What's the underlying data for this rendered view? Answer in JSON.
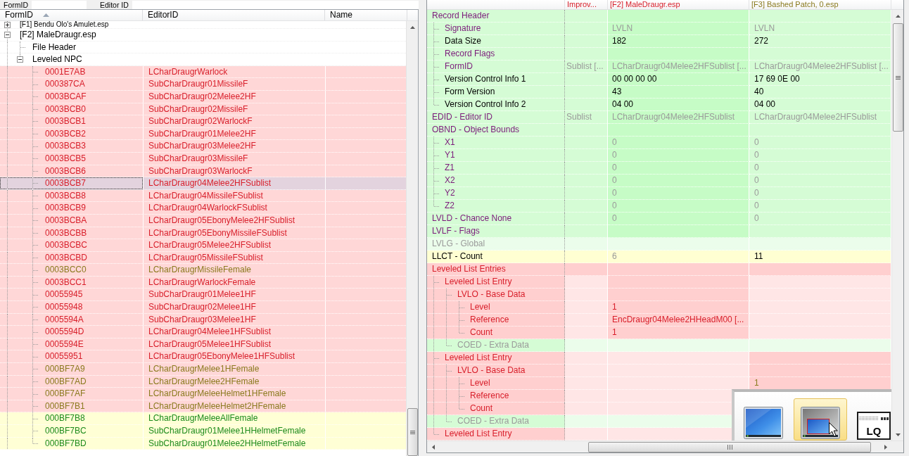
{
  "filter_bar": [
    {
      "label": "FormID"
    },
    {
      "label": "Editor ID"
    }
  ],
  "navigator": {
    "columns": [
      {
        "label": "FormID",
        "sorted": true
      },
      {
        "label": "EditorID",
        "sorted": false
      },
      {
        "label": "Name",
        "sorted": false
      }
    ],
    "tree": [
      {
        "label": "[F1] Bendu Olo's Amulet.esp",
        "expanded": false
      },
      {
        "label": "[F2] MaleDraugr.esp",
        "expanded": true,
        "children": [
          {
            "label": "File Header"
          },
          {
            "label": "Leveled NPC",
            "expanded": true,
            "children": [
              {
                "form_id": "0001E7AB",
                "editor_id": "LCharDraugrWarlock",
                "color": "#d81e2a",
                "fill": {
                  "color": "#ffd7d7"
                },
                "selected": false
              },
              {
                "form_id": "000387CA",
                "editor_id": "SubCharDraugr01MissileF",
                "color": "#d81e2a",
                "fill": {
                  "color": "#ffd7d7"
                },
                "selected": false
              },
              {
                "form_id": "0003BCAF",
                "editor_id": "SubCharDraugr02Melee2HF",
                "color": "#d81e2a",
                "fill": {
                  "color": "#ffd7d7"
                },
                "selected": false
              },
              {
                "form_id": "0003BCB0",
                "editor_id": "SubCharDraugr02MissileF",
                "color": "#d81e2a",
                "fill": {
                  "color": "#ffd7d7"
                },
                "selected": false
              },
              {
                "form_id": "0003BCB1",
                "editor_id": "SubCharDraugr02WarlockF",
                "color": "#d81e2a",
                "fill": {
                  "color": "#ffd7d7"
                },
                "selected": false
              },
              {
                "form_id": "0003BCB2",
                "editor_id": "SubCharDraugr01Melee2HF",
                "color": "#d81e2a",
                "fill": {
                  "color": "#ffd7d7"
                },
                "selected": false
              },
              {
                "form_id": "0003BCB3",
                "editor_id": "SubCharDraugr03Melee2HF",
                "color": "#d81e2a",
                "fill": {
                  "color": "#ffd7d7"
                },
                "selected": false
              },
              {
                "form_id": "0003BCB5",
                "editor_id": "SubCharDraugr03MissileF",
                "color": "#d81e2a",
                "fill": {
                  "color": "#ffd7d7"
                },
                "selected": false
              },
              {
                "form_id": "0003BCB6",
                "editor_id": "SubCharDraugr03WarlockF",
                "color": "#d81e2a",
                "fill": {
                  "color": "#ffd7d7"
                },
                "selected": false
              },
              {
                "form_id": "0003BCB7",
                "editor_id": "LCharDraugr04Melee2HFSublist",
                "color": "#d81e2a",
                "selected": true
              },
              {
                "form_id": "0003BCB8",
                "editor_id": "LCharDraugr04MissileFSublist",
                "color": "#d81e2a",
                "fill": {
                  "color": "#ffd7d7"
                },
                "selected": false
              },
              {
                "form_id": "0003BCB9",
                "editor_id": "LCharDraugr04WarlockFSublist",
                "color": "#d81e2a",
                "fill": {
                  "color": "#ffd7d7"
                },
                "selected": false
              },
              {
                "form_id": "0003BCBA",
                "editor_id": "LCharDraugr05EbonyMelee2HFSublist",
                "color": "#d81e2a",
                "fill": {
                  "color": "#ffd7d7"
                },
                "selected": false
              },
              {
                "form_id": "0003BCBB",
                "editor_id": "LCharDraugr05EbonyMissileFSublist",
                "color": "#d81e2a",
                "fill": {
                  "color": "#ffd7d7"
                },
                "selected": false
              },
              {
                "form_id": "0003BCBC",
                "editor_id": "LCharDraugr05Melee2HFSublist",
                "color": "#d81e2a",
                "fill": {
                  "color": "#ffd7d7"
                },
                "selected": false
              },
              {
                "form_id": "0003BCBD",
                "editor_id": "LCharDraugr05MissileFSublist",
                "color": "#d81e2a",
                "fill": {
                  "color": "#ffd7d7"
                },
                "selected": false
              },
              {
                "form_id": "0003BCC0",
                "editor_id": "LCharDraugrMissileFemale",
                "color": "#8a7a1e",
                "fill": {
                  "color": "#ffd7d7"
                },
                "selected": false
              },
              {
                "form_id": "0003BCC1",
                "editor_id": "LCharDraugrWarlockFemale",
                "color": "#d81e2a",
                "fill": {
                  "color": "#ffd7d7"
                },
                "selected": false
              },
              {
                "form_id": "00055945",
                "editor_id": "SubCharDraugr01Melee1HF",
                "color": "#d81e2a",
                "fill": {
                  "color": "#ffd7d7"
                },
                "selected": false
              },
              {
                "form_id": "00055948",
                "editor_id": "SubCharDraugr02Melee1HF",
                "color": "#d81e2a",
                "fill": {
                  "color": "#ffd7d7"
                },
                "selected": false
              },
              {
                "form_id": "0005594A",
                "editor_id": "SubCharDraugr03Melee1HF",
                "color": "#d81e2a",
                "fill": {
                  "color": "#ffd7d7"
                },
                "selected": false
              },
              {
                "form_id": "0005594D",
                "editor_id": "LCharDraugr04Melee1HFSublist",
                "color": "#d81e2a",
                "fill": {
                  "color": "#ffd7d7"
                },
                "selected": false
              },
              {
                "form_id": "0005594E",
                "editor_id": "LCharDraugr05Melee1HFSublist",
                "color": "#d81e2a",
                "fill": {
                  "color": "#ffd7d7"
                },
                "selected": false
              },
              {
                "form_id": "00055951",
                "editor_id": "LCharDraugr05EbonyMelee1HFSublist",
                "color": "#d81e2a",
                "fill": {
                  "color": "#ffd7d7"
                },
                "selected": false
              },
              {
                "form_id": "000BF7A9",
                "editor_id": "LCharDraugrMelee1HFemale",
                "color": "#8a7a1e",
                "fill": {
                  "color": "#ffd7d7"
                },
                "selected": false
              },
              {
                "form_id": "000BF7AD",
                "editor_id": "LCharDraugrMelee2HFemale",
                "color": "#8a7a1e",
                "fill": {
                  "color": "#ffd7d7"
                },
                "selected": false
              },
              {
                "form_id": "000BF7AF",
                "editor_id": "LCharDraugrMeleeHelmet1HFemale",
                "color": "#8a7a1e",
                "fill": {
                  "color": "#ffd7d7"
                },
                "selected": false
              },
              {
                "form_id": "000BF7B1",
                "editor_id": "LCharDraugrMeleeHelmet2HFemale",
                "color": "#8a7a1e",
                "fill": {
                  "color": "#ffd7d7"
                },
                "selected": false
              },
              {
                "form_id": "000BF7B8",
                "editor_id": "LCharDraugrMeleeAllFemale",
                "color": "#1c8a1c",
                "fill": {
                  "color": "#ffffd5"
                },
                "selected": false
              },
              {
                "form_id": "000BF7BC",
                "editor_id": "SubCharDraugr01Melee1HHelmetFemale",
                "color": "#1c8a1c",
                "fill": {
                  "color": "#ffffd5"
                },
                "selected": false
              },
              {
                "form_id": "000BF7BD",
                "editor_id": "SubCharDraugr01Melee2HHelmetFemale",
                "color": "#1c8a1c",
                "fill": {
                  "color": "#ffffd5"
                },
                "selected": false
              }
            ]
          }
        ]
      }
    ]
  },
  "record_view": {
    "columns": [
      {
        "label": "Improv...",
        "color": "#d81e2a"
      },
      {
        "label": "[F2] MaleDraugr.esp",
        "color": "#d81e2a"
      },
      {
        "label": "[F3] Bashed Patch, 0.esp",
        "color": "#8a7a1e"
      }
    ],
    "rows": [
      {
        "label": "Record Header",
        "color": "#7b1b7b",
        "fill": {
          "color": "#d5fcd5"
        },
        "cells": [
          {
            "fill": {
              "color": "#d5fcd5"
            }
          },
          {
            "fill": {
              "color": "#c6fcc6"
            }
          },
          {
            "fill": {
              "color": "#d5fcd5"
            }
          }
        ],
        "children": [
          {
            "label": "Signature",
            "color": "#7b1b7b",
            "fill": {
              "color": "#d5fcd5"
            },
            "cells": [
              {
                "fill": {
                  "color": "#d5fcd5"
                }
              },
              {
                "text": "LVLN",
                "color": "#9a9a9a",
                "fill": {
                  "color": "#c6fcc6"
                }
              },
              {
                "text": "LVLN",
                "color": "#9a9a9a",
                "fill": {
                  "color": "#d5fcd5"
                }
              }
            ]
          },
          {
            "label": "Data Size",
            "color": "#000000",
            "fill": {
              "color": "#d5fcd5"
            },
            "cells": [
              {
                "fill": {
                  "color": "#d5fcd5"
                }
              },
              {
                "text": "182",
                "color": "#000000",
                "fill": {
                  "color": "#c6fcc6"
                }
              },
              {
                "text": "272",
                "color": "#000000",
                "fill": {
                  "color": "#d5fcd5"
                }
              }
            ]
          },
          {
            "label": "Record Flags",
            "color": "#7b1b7b",
            "fill": {
              "color": "#d5fcd5"
            },
            "cells": [
              {
                "fill": {
                  "color": "#d5fcd5"
                }
              },
              {
                "fill": {
                  "color": "#c6fcc6"
                }
              },
              {
                "fill": {
                  "color": "#d5fcd5"
                }
              }
            ]
          },
          {
            "label": "FormID",
            "color": "#7b1b7b",
            "fill": {
              "color": "#d5fcd5"
            },
            "cells": [
              {
                "text": "Sublist [...",
                "color": "#9a9a9a",
                "fill": {
                  "color": "#d5fcd5"
                }
              },
              {
                "text": "LCharDraugr04Melee2HFSublist [...",
                "color": "#9a9a9a",
                "fill": {
                  "color": "#c6fcc6"
                }
              },
              {
                "text": "LCharDraugr04Melee2HFSublist [...",
                "color": "#9a9a9a",
                "fill": {
                  "color": "#d5fcd5"
                }
              }
            ]
          },
          {
            "label": "Version Control Info 1",
            "color": "#000000",
            "fill": {
              "color": "#d5fcd5"
            },
            "cells": [
              {
                "fill": {
                  "color": "#d5fcd5"
                }
              },
              {
                "text": "00 00 00 00",
                "color": "#000000",
                "fill": {
                  "color": "#c6fcc6"
                }
              },
              {
                "text": "17 69 0E 00",
                "color": "#000000",
                "fill": {
                  "color": "#d5fcd5"
                }
              }
            ]
          },
          {
            "label": "Form Version",
            "color": "#000000",
            "fill": {
              "color": "#d5fcd5"
            },
            "cells": [
              {
                "fill": {
                  "color": "#d5fcd5"
                }
              },
              {
                "text": "43",
                "color": "#000000",
                "fill": {
                  "color": "#c6fcc6"
                }
              },
              {
                "text": "40",
                "color": "#000000",
                "fill": {
                  "color": "#d5fcd5"
                }
              }
            ]
          },
          {
            "label": "Version Control Info 2",
            "color": "#000000",
            "fill": {
              "color": "#d5fcd5"
            },
            "cells": [
              {
                "fill": {
                  "color": "#d5fcd5"
                }
              },
              {
                "text": "04 00",
                "color": "#000000",
                "fill": {
                  "color": "#c6fcc6"
                }
              },
              {
                "text": "04 00",
                "color": "#000000",
                "fill": {
                  "color": "#d5fcd5"
                }
              }
            ]
          }
        ]
      },
      {
        "label": "EDID - Editor ID",
        "color": "#7b1b7b",
        "fill": {
          "color": "#d5fcd5"
        },
        "cells": [
          {
            "text": "Sublist",
            "color": "#9a9a9a",
            "fill": {
              "color": "#d5fcd5"
            }
          },
          {
            "text": "LCharDraugr04Melee2HFSublist",
            "color": "#9a9a9a",
            "fill": {
              "color": "#c6fcc6"
            }
          },
          {
            "text": "LCharDraugr04Melee2HFSublist",
            "color": "#9a9a9a",
            "fill": {
              "color": "#d5fcd5"
            }
          }
        ]
      },
      {
        "label": "OBND - Object Bounds",
        "color": "#7b1b7b",
        "fill": {
          "color": "#d5fcd5"
        },
        "cells": [
          {
            "fill": {
              "color": "#d5fcd5"
            }
          },
          {
            "fill": {
              "color": "#c6fcc6"
            }
          },
          {
            "fill": {
              "color": "#d5fcd5"
            }
          }
        ],
        "children": [
          {
            "label": "X1",
            "color": "#7b1b7b",
            "fill": {
              "color": "#d5fcd5"
            },
            "cells": [
              {
                "fill": {
                  "color": "#d5fcd5"
                }
              },
              {
                "text": "0",
                "color": "#9a9a9a",
                "fill": {
                  "color": "#c6fcc6"
                }
              },
              {
                "text": "0",
                "color": "#9a9a9a",
                "fill": {
                  "color": "#d5fcd5"
                }
              }
            ]
          },
          {
            "label": "Y1",
            "color": "#7b1b7b",
            "fill": {
              "color": "#d5fcd5"
            },
            "cells": [
              {
                "fill": {
                  "color": "#d5fcd5"
                }
              },
              {
                "text": "0",
                "color": "#9a9a9a",
                "fill": {
                  "color": "#c6fcc6"
                }
              },
              {
                "text": "0",
                "color": "#9a9a9a",
                "fill": {
                  "color": "#d5fcd5"
                }
              }
            ]
          },
          {
            "label": "Z1",
            "color": "#7b1b7b",
            "fill": {
              "color": "#d5fcd5"
            },
            "cells": [
              {
                "fill": {
                  "color": "#d5fcd5"
                }
              },
              {
                "text": "0",
                "color": "#9a9a9a",
                "fill": {
                  "color": "#c6fcc6"
                }
              },
              {
                "text": "0",
                "color": "#9a9a9a",
                "fill": {
                  "color": "#d5fcd5"
                }
              }
            ]
          },
          {
            "label": "X2",
            "color": "#7b1b7b",
            "fill": {
              "color": "#d5fcd5"
            },
            "cells": [
              {
                "fill": {
                  "color": "#d5fcd5"
                }
              },
              {
                "text": "0",
                "color": "#9a9a9a",
                "fill": {
                  "color": "#c6fcc6"
                }
              },
              {
                "text": "0",
                "color": "#9a9a9a",
                "fill": {
                  "color": "#d5fcd5"
                }
              }
            ]
          },
          {
            "label": "Y2",
            "color": "#7b1b7b",
            "fill": {
              "color": "#d5fcd5"
            },
            "cells": [
              {
                "fill": {
                  "color": "#d5fcd5"
                }
              },
              {
                "text": "0",
                "color": "#9a9a9a",
                "fill": {
                  "color": "#c6fcc6"
                }
              },
              {
                "text": "0",
                "color": "#9a9a9a",
                "fill": {
                  "color": "#d5fcd5"
                }
              }
            ]
          },
          {
            "label": "Z2",
            "color": "#7b1b7b",
            "fill": {
              "color": "#d5fcd5"
            },
            "cells": [
              {
                "fill": {
                  "color": "#d5fcd5"
                }
              },
              {
                "text": "0",
                "color": "#9a9a9a",
                "fill": {
                  "color": "#c6fcc6"
                }
              },
              {
                "text": "0",
                "color": "#9a9a9a",
                "fill": {
                  "color": "#d5fcd5"
                }
              }
            ]
          }
        ]
      },
      {
        "label": "LVLD - Chance None",
        "color": "#7b1b7b",
        "fill": {
          "color": "#d5fcd5"
        },
        "cells": [
          {
            "fill": {
              "color": "#d5fcd5"
            }
          },
          {
            "text": "0",
            "color": "#9a9a9a",
            "fill": {
              "color": "#c6fcc6"
            }
          },
          {
            "text": "0",
            "color": "#9a9a9a",
            "fill": {
              "color": "#d5fcd5"
            }
          }
        ]
      },
      {
        "label": "LVLF - Flags",
        "color": "#7b1b7b",
        "fill": {
          "color": "#d5fcd5"
        },
        "cells": [
          {
            "fill": {
              "color": "#d5fcd5"
            }
          },
          {
            "fill": {
              "color": "#c6fcc6"
            }
          },
          {
            "fill": {
              "color": "#d5fcd5"
            }
          }
        ]
      },
      {
        "label": "LVLG - Global",
        "color": "#9a9a9a",
        "fill": {
          "color": "#ebfdeb"
        },
        "cells": [
          {
            "fill": {
              "color": "#ebfdeb"
            }
          },
          {
            "fill": {
              "color": "#ebfdeb"
            }
          },
          {
            "fill": {
              "color": "#ebfdeb"
            }
          }
        ]
      },
      {
        "label": "LLCT - Count",
        "color": "#000000",
        "fill": {
          "color": "#ffffd2"
        },
        "cells": [
          {
            "fill": {
              "color": "#ffffd2"
            }
          },
          {
            "text": "6",
            "color": "#9a9a9a",
            "fill": {
              "color": "#ffffd2"
            }
          },
          {
            "text": "11",
            "color": "#000000",
            "fill": {
              "color": "#ffffd2"
            }
          }
        ]
      },
      {
        "label": "Leveled List Entries",
        "color": "#d81e2a",
        "fill": {
          "color": "#ffcfcf"
        },
        "cells": [
          {
            "fill": {
              "color": "#ffcfcf"
            }
          },
          {
            "fill": {
              "color": "#ffcfcf"
            }
          },
          {
            "fill": {
              "color": "#ffcfcf"
            }
          }
        ],
        "children": [
          {
            "label": "Leveled List Entry",
            "color": "#d81e2a",
            "fill": {
              "color": "#ffcfcf"
            },
            "cells": [
              {
                "fill": {
                  "color": "#ffe6e6"
                }
              },
              {
                "fill": {
                  "color": "#ffcfcf"
                }
              },
              {
                "fill": {
                  "color": "#ffe6e6"
                }
              }
            ],
            "children": [
              {
                "label": "LVLO - Base Data",
                "color": "#d81e2a",
                "fill": {
                  "color": "#ffcfcf"
                },
                "cells": [
                  {
                    "fill": {
                      "color": "#ffe6e6"
                    }
                  },
                  {
                    "fill": {
                      "color": "#ffcfcf"
                    }
                  },
                  {
                    "fill": {
                      "color": "#ffe6e6"
                    }
                  }
                ],
                "children": [
                  {
                    "label": "Level",
                    "color": "#d81e2a",
                    "fill": {
                      "color": "#ffcfcf"
                    },
                    "cells": [
                      {
                        "fill": {
                          "color": "#ffe6e6"
                        }
                      },
                      {
                        "text": "1",
                        "color": "#d81e2a",
                        "fill": {
                          "color": "#ffcfcf"
                        }
                      },
                      {
                        "fill": {
                          "color": "#ffe6e6"
                        }
                      }
                    ]
                  },
                  {
                    "label": "Reference",
                    "color": "#d81e2a",
                    "fill": {
                      "color": "#ffcfcf"
                    },
                    "cells": [
                      {
                        "fill": {
                          "color": "#ffe6e6"
                        }
                      },
                      {
                        "text": "EncDraugr04Melee2HHeadM00 [...",
                        "color": "#d81e2a",
                        "fill": {
                          "color": "#ffcfcf"
                        }
                      },
                      {
                        "fill": {
                          "color": "#ffe6e6"
                        }
                      }
                    ]
                  },
                  {
                    "label": "Count",
                    "color": "#d81e2a",
                    "fill": {
                      "color": "#ffcfcf"
                    },
                    "cells": [
                      {
                        "fill": {
                          "color": "#ffe6e6"
                        }
                      },
                      {
                        "text": "1",
                        "color": "#d81e2a",
                        "fill": {
                          "color": "#ffcfcf"
                        }
                      },
                      {
                        "fill": {
                          "color": "#ffe6e6"
                        }
                      }
                    ]
                  }
                ]
              },
              {
                "label": "COED - Extra Data",
                "color": "#9a9a9a",
                "fill": {
                  "color": "#d5fcd5"
                },
                "cells": [
                  {
                    "fill": {
                      "color": "#ebfdeb"
                    }
                  },
                  {
                    "fill": {
                      "color": "#ebfdeb"
                    }
                  },
                  {
                    "fill": {
                      "color": "#ebfdeb"
                    }
                  }
                ]
              }
            ]
          },
          {
            "label": "Leveled List Entry",
            "color": "#d81e2a",
            "fill": {
              "color": "#ffcfcf"
            },
            "cells": [
              {
                "fill": {
                  "color": "#ffe6e6"
                }
              },
              {
                "fill": {
                  "color": "#ffe6e6"
                }
              },
              {
                "fill": {
                  "color": "#ffcfcf"
                }
              }
            ],
            "children": [
              {
                "label": "LVLO - Base Data",
                "color": "#d81e2a",
                "fill": {
                  "color": "#ffcfcf"
                },
                "cells": [
                  {
                    "fill": {
                      "color": "#ffe6e6"
                    }
                  },
                  {
                    "fill": {
                      "color": "#ffe6e6"
                    }
                  },
                  {
                    "fill": {
                      "color": "#ffcfcf"
                    }
                  }
                ],
                "children": [
                  {
                    "label": "Level",
                    "color": "#d81e2a",
                    "fill": {
                      "color": "#ffcfcf"
                    },
                    "cells": [
                      {
                        "fill": {
                          "color": "#ffe6e6"
                        }
                      },
                      {
                        "fill": {
                          "color": "#ffe6e6"
                        }
                      },
                      {
                        "text": "1",
                        "color": "#8a7a1e",
                        "fill": {
                          "color": "#ffcfcf"
                        }
                      }
                    ]
                  },
                  {
                    "label": "Reference",
                    "color": "#d81e2a",
                    "fill": {
                      "color": "#ffcfcf"
                    },
                    "cells": [
                      {
                        "fill": {
                          "color": "#ffe6e6"
                        }
                      },
                      {
                        "fill": {
                          "color": "#ffe6e6"
                        }
                      }
                    ]
                  },
                  {
                    "label": "Count",
                    "color": "#d81e2a",
                    "fill": {
                      "color": "#ffcfcf"
                    },
                    "cells": [
                      {
                        "fill": {
                          "color": "#ffe6e6"
                        }
                      },
                      {
                        "fill": {
                          "color": "#ffe6e6"
                        }
                      }
                    ]
                  }
                ]
              },
              {
                "label": "COED - Extra Data",
                "color": "#9a9a9a",
                "fill": {
                  "color": "#d5fcd5"
                },
                "cells": [
                  {
                    "fill": {
                      "color": "#ebfdeb"
                    }
                  },
                  {
                    "fill": {
                      "color": "#ebfdeb"
                    }
                  }
                ]
              }
            ]
          },
          {
            "label": "Leveled List Entry",
            "color": "#d81e2a",
            "fill": {
              "color": "#ffcfcf"
            },
            "cells": [
              {
                "fill": {
                  "color": "#ffe6e6"
                }
              },
              {
                "fill": {
                  "color": "#ffe6e6"
                }
              }
            ]
          }
        ]
      }
    ]
  },
  "display_popup": {
    "options": [
      {
        "kind": "monitor",
        "selected": false
      },
      {
        "kind": "monitor_inset",
        "selected": true
      },
      {
        "kind": "window",
        "label": "LQ",
        "selected": false
      }
    ]
  }
}
